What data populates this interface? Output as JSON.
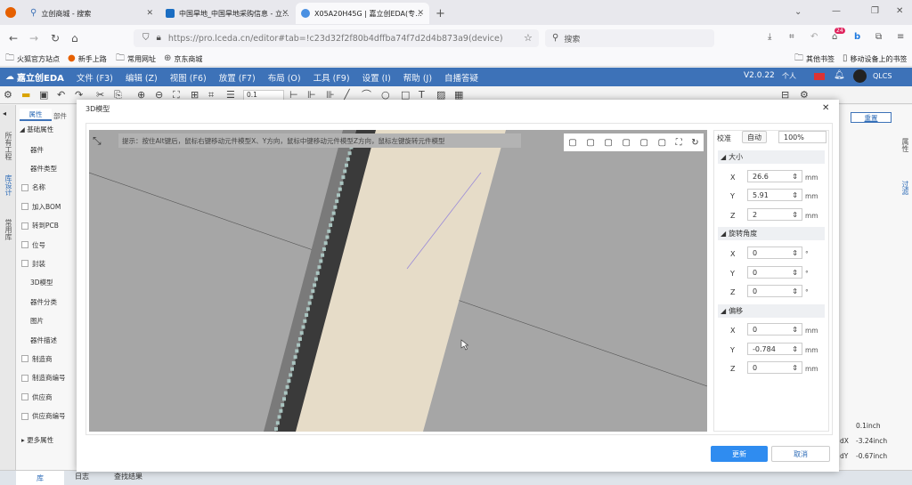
{
  "browser": {
    "tabs": [
      {
        "label": "立创商城 - 搜索",
        "icon": "search-icon"
      },
      {
        "label": "中国旱地_中国旱地采购信息 - 立...",
        "icon": "lcsc-icon"
      },
      {
        "label": "X05A20H45G | 嘉立创EDA(专...",
        "icon": "eda-icon"
      }
    ],
    "url": "https://pro.lceda.cn/editor#tab=!c23d32f2f80b4dffba74f7d2d4b873a9(device)",
    "search_placeholder": "搜索",
    "badge": "24",
    "bookmarks": [
      "火狐官方站点",
      "新手上路",
      "常用网址",
      "京东商城"
    ],
    "bookmarks_right": [
      "其他书签",
      "移动设备上的书签"
    ]
  },
  "app": {
    "brand": "嘉立创EDA",
    "menus": [
      "文件 (F3)",
      "编辑 (Z)",
      "视图 (F6)",
      "放置 (F7)",
      "布局 (O)",
      "工具 (F9)",
      "设置 (I)",
      "帮助 (J)",
      "自播答疑"
    ],
    "version": "V2.0.22",
    "user_label": "个人",
    "username": "QLCS",
    "zoom_value": "0.1"
  },
  "left": {
    "strip_top": "所有工程",
    "strip_mid": "库设计",
    "strip_bot": "常用库",
    "tabs": [
      "属性",
      "部件"
    ],
    "section": "基础属性",
    "items": [
      {
        "label": "器件",
        "checkbox": false
      },
      {
        "label": "器件类型",
        "checkbox": false
      },
      {
        "label": "名称",
        "checkbox": true
      },
      {
        "label": "加入BOM",
        "checkbox": true
      },
      {
        "label": "转到PCB",
        "checkbox": true
      },
      {
        "label": "位号",
        "checkbox": true
      },
      {
        "label": "封装",
        "checkbox": true
      },
      {
        "label": "3D模型",
        "checkbox": false
      },
      {
        "label": "器件分类",
        "checkbox": false
      },
      {
        "label": "图片",
        "checkbox": false
      },
      {
        "label": "器件描述",
        "checkbox": false
      },
      {
        "label": "制造商",
        "checkbox": true
      },
      {
        "label": "制造商编号",
        "checkbox": true
      },
      {
        "label": "供应商",
        "checkbox": true
      },
      {
        "label": "供应商编号",
        "checkbox": true
      }
    ],
    "more": "更多属性"
  },
  "right": {
    "reset": "重置",
    "tab1": "属性",
    "tab2": "过滤",
    "rows": [
      {
        "label": "",
        "value": "0.1inch"
      },
      {
        "label": "dX",
        "value": "-3.24inch"
      },
      {
        "label": "dY",
        "value": "-0.67inch"
      }
    ]
  },
  "bottom": {
    "tabs": [
      "库",
      "日志",
      "查找结果"
    ]
  },
  "modal": {
    "title": "3D模型",
    "hint": "提示：按住Alt键后，鼠标右键移动元件模型X、Y方向，鼠标中键移动元件模型Z方向，鼠标左键旋转元件模型",
    "calibrate_label": "校准",
    "auto_label": "自动",
    "scale_value": "100%",
    "size": {
      "title": "大小",
      "x": "26.6",
      "y": "5.91",
      "z": "2",
      "unit": "mm"
    },
    "rotation": {
      "title": "旋转角度",
      "x": "0",
      "y": "0",
      "z": "0",
      "unit": "°"
    },
    "offset": {
      "title": "偏移",
      "x": "0",
      "y": "-0.784",
      "z": "0",
      "unit": "mm"
    },
    "update_label": "更新",
    "cancel_label": "取消"
  },
  "colors": {
    "menubar": "#3d72b8",
    "primary_button": "#2f8cf0",
    "viewport_bg": "#a6a6a6",
    "board": "#e6dcc8",
    "pins": "#3a3a3a"
  }
}
